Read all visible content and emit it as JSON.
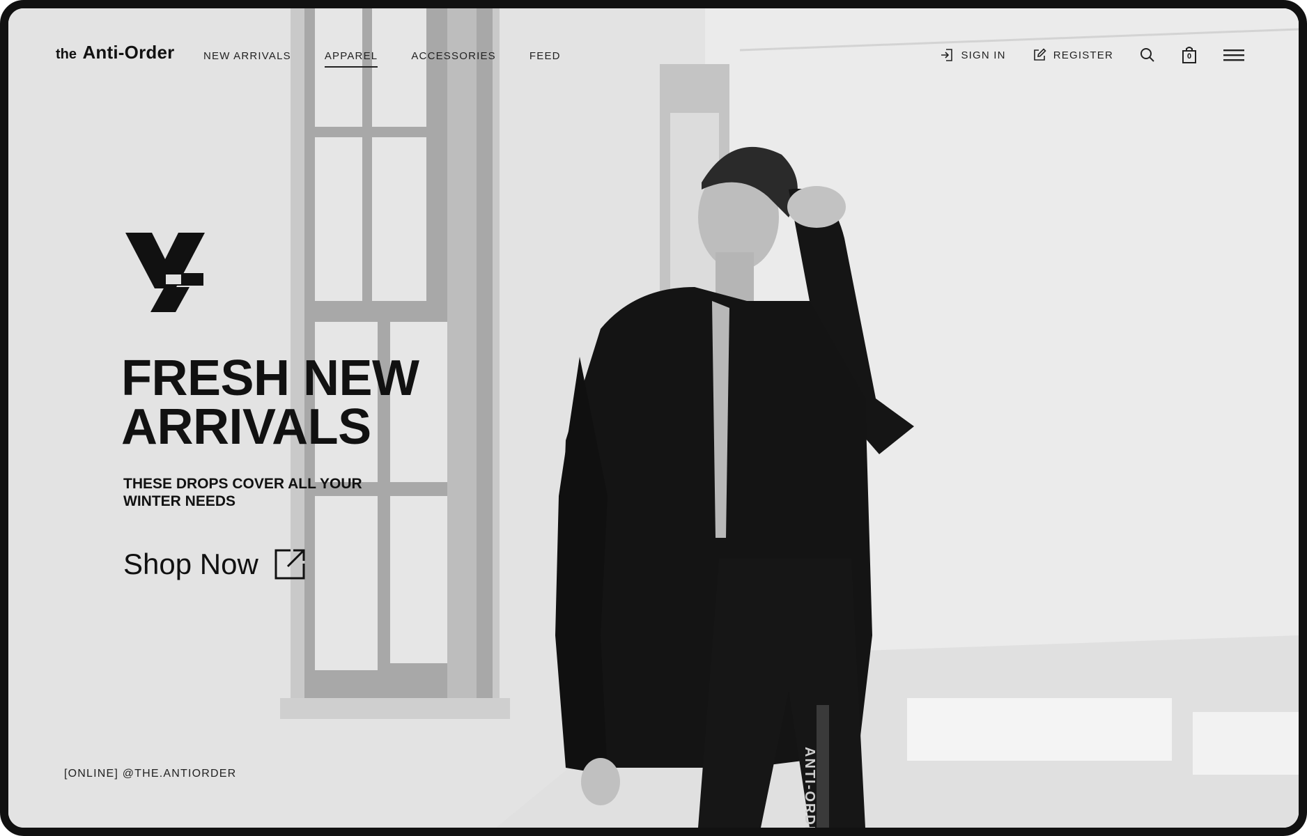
{
  "brand": {
    "prefix": "the",
    "name": "Anti-Order"
  },
  "nav": {
    "links": [
      {
        "label": "NEW ARRIVALS",
        "active": false
      },
      {
        "label": "APPAREL",
        "active": true
      },
      {
        "label": "ACCESSORIES",
        "active": false
      },
      {
        "label": "FEED",
        "active": false
      }
    ],
    "sign_in": "SIGN IN",
    "register": "REGISTER",
    "cart_count": "0",
    "icons": [
      "sign-in-icon",
      "register-icon",
      "search-icon",
      "shopping-bag-icon",
      "menu-icon"
    ]
  },
  "hero": {
    "headline_line1": "FRESH NEW",
    "headline_line2": "ARRIVALS",
    "subheading": "THESE DROPS COVER ALL YOUR WINTER NEEDS",
    "cta_label": "Shop Now",
    "cta_icon": "external-link-icon",
    "social_handle": "[ONLINE] @THE.ANTIORDER",
    "pants_text": "ANTI-ORDER"
  },
  "colors": {
    "frame": "#111111",
    "text": "#111111",
    "background": "#e4e4e4"
  }
}
